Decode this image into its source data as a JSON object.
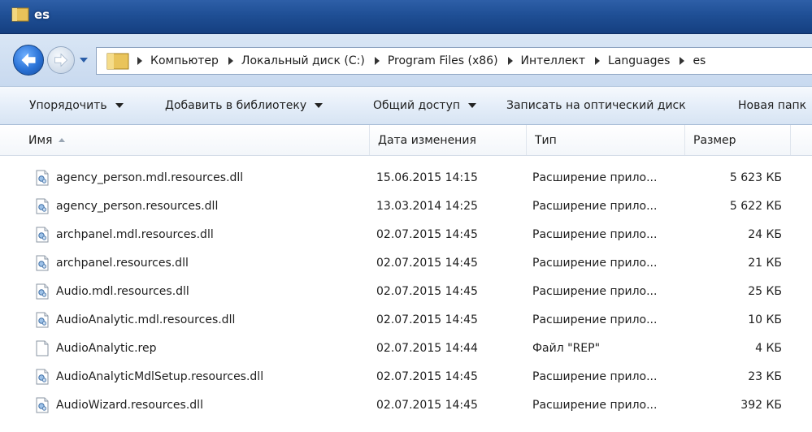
{
  "window": {
    "title": "es"
  },
  "breadcrumbs": [
    "Компьютер",
    "Локальный диск (C:)",
    "Program Files (x86)",
    "Интеллект",
    "Languages",
    "es"
  ],
  "toolbar": {
    "organize": "Упорядочить",
    "add_to_library": "Добавить в библиотеку",
    "share": "Общий доступ",
    "burn": "Записать на оптический диск",
    "new_folder": "Новая папк"
  },
  "columns": {
    "name": "Имя",
    "date": "Дата изменения",
    "type": "Тип",
    "size": "Размер"
  },
  "files": [
    {
      "name": "agency_person.mdl.resources.dll",
      "date": "15.06.2015 14:15",
      "type": "Расширение прило...",
      "size": "5 623 КБ",
      "icon": "dll"
    },
    {
      "name": "agency_person.resources.dll",
      "date": "13.03.2014 14:25",
      "type": "Расширение прило...",
      "size": "5 622 КБ",
      "icon": "dll"
    },
    {
      "name": "archpanel.mdl.resources.dll",
      "date": "02.07.2015 14:45",
      "type": "Расширение прило...",
      "size": "24 КБ",
      "icon": "dll"
    },
    {
      "name": "archpanel.resources.dll",
      "date": "02.07.2015 14:45",
      "type": "Расширение прило...",
      "size": "21 КБ",
      "icon": "dll"
    },
    {
      "name": "Audio.mdl.resources.dll",
      "date": "02.07.2015 14:45",
      "type": "Расширение прило...",
      "size": "25 КБ",
      "icon": "dll"
    },
    {
      "name": "AudioAnalytic.mdl.resources.dll",
      "date": "02.07.2015 14:45",
      "type": "Расширение прило...",
      "size": "10 КБ",
      "icon": "dll"
    },
    {
      "name": "AudioAnalytic.rep",
      "date": "02.07.2015 14:44",
      "type": "Файл \"REP\"",
      "size": "4 КБ",
      "icon": "blank-file"
    },
    {
      "name": "AudioAnalyticMdlSetup.resources.dll",
      "date": "02.07.2015 14:45",
      "type": "Расширение прило...",
      "size": "23 КБ",
      "icon": "dll"
    },
    {
      "name": "AudioWizard.resources.dll",
      "date": "02.07.2015 14:45",
      "type": "Расширение прило...",
      "size": "392 КБ",
      "icon": "dll"
    }
  ]
}
